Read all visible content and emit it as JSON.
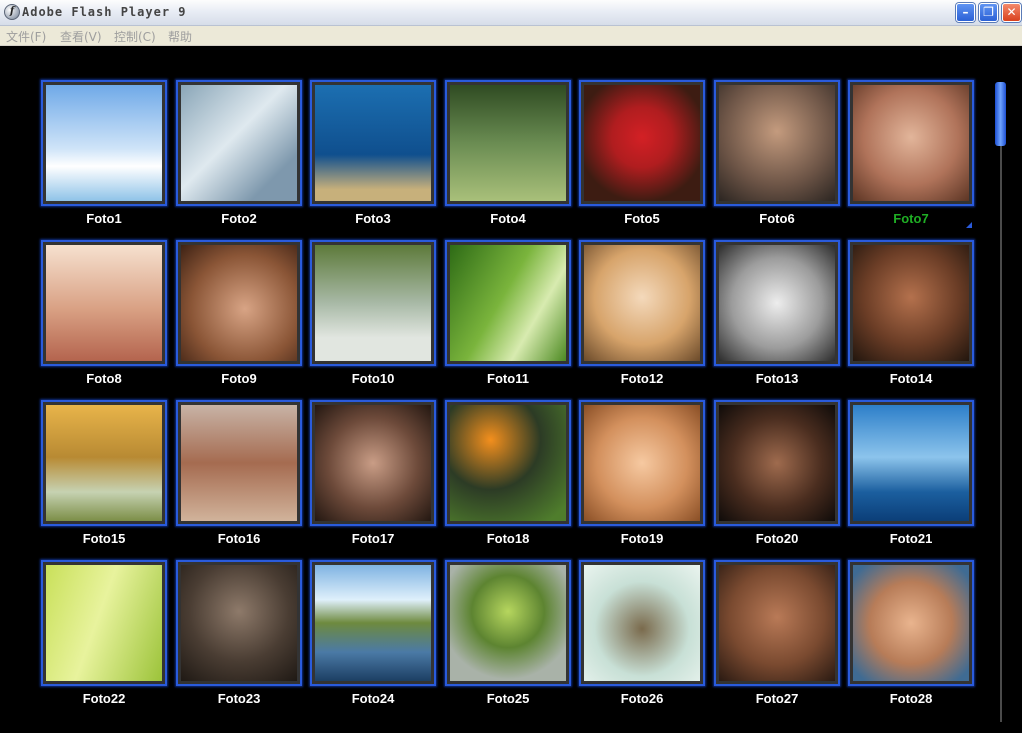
{
  "window": {
    "title": "Adobe Flash Player 9"
  },
  "menu": [
    "文件(F)",
    "查看(V)",
    "控制(C)",
    "帮助"
  ],
  "selected_index": 6,
  "photos": [
    {
      "label": "Foto1",
      "bg": "linear-gradient(#6fa9e8 0%, #cfe4f8 55%, #ffffff 70%, #8fc3e8 100%)"
    },
    {
      "label": "Foto2",
      "bg": "linear-gradient(135deg, #8aa6b8, #dfe9ef 45%, #7e98ad 80%)"
    },
    {
      "label": "Foto3",
      "bg": "linear-gradient(#1c6fb1, #0f4f8e 60%, #c7b07b 90%)"
    },
    {
      "label": "Foto4",
      "bg": "linear-gradient(#2f4b22, #6a8c52 50%, #a9c07a 100%)"
    },
    {
      "label": "Foto5",
      "bg": "radial-gradient(circle at 50% 45%, #d32025 0%, #b01d1f 35%, #3d1c12 75%)"
    },
    {
      "label": "Foto6",
      "bg": "radial-gradient(circle at 50% 40%, #c49b7e, #6c5446 60%, #2b2521)"
    },
    {
      "label": "Foto7",
      "bg": "radial-gradient(circle at 50% 45%, #e2b59a, #b0735a 55%, #5c3524)"
    },
    {
      "label": "Foto8",
      "bg": "linear-gradient(#f6e1cf, #d9a184 55%, #b4644e)"
    },
    {
      "label": "Foto9",
      "bg": "radial-gradient(circle at 55% 55%, #d8a485, #8a5536 60%, #3e2214)"
    },
    {
      "label": "Foto10",
      "bg": "linear-gradient(#5d7a3a, #a8b9a6 50%, #e1e6e0 80%)"
    },
    {
      "label": "Foto11",
      "bg": "linear-gradient(120deg, #2e6b16, #7ab43c 45%, #d8ebb0 70%, #4d8a22)"
    },
    {
      "label": "Foto12",
      "bg": "radial-gradient(circle at 50% 45%, #f4d9bb, #d7a46b 55%, #6b4a2a)"
    },
    {
      "label": "Foto13",
      "bg": "radial-gradient(circle at 50% 50%, #ededed, #9c9c9c 55%, #2c2c2c)"
    },
    {
      "label": "Foto14",
      "bg": "radial-gradient(circle at 50% 45%, #b4714d, #6b3d26 55%, #22160e)"
    },
    {
      "label": "Foto15",
      "bg": "linear-gradient(#e8b44a, #b88a33 45%, #c6d2b2 75%, #7c8e47)"
    },
    {
      "label": "Foto16",
      "bg": "linear-gradient(#c8b3a6, #a56b50 50%, #d1b39b)"
    },
    {
      "label": "Foto17",
      "bg": "radial-gradient(circle at 50% 50%, #c99d86, #6d4a3a 55%, #231711)"
    },
    {
      "label": "Foto18",
      "bg": "radial-gradient(circle at 35% 30%, #f38f1d, #2c3b25 45%, #4f7d2c 90%)"
    },
    {
      "label": "Foto19",
      "bg": "radial-gradient(circle at 50% 50%, #f6c9a1, #d3905d 55%, #8a4f26)"
    },
    {
      "label": "Foto20",
      "bg": "radial-gradient(circle at 50% 50%, #9f6b4e, #4a2d1f 55%, #0f0b09)"
    },
    {
      "label": "Foto21",
      "bg": "linear-gradient(#2d7fc9, #8cc4ec 45%, #1b5f9f 75%, #0b3e78)"
    },
    {
      "label": "Foto22",
      "bg": "linear-gradient(110deg, #c9e05a, #e8f39d 45%, #9cc33a)"
    },
    {
      "label": "Foto23",
      "bg": "radial-gradient(circle at 50% 40%, #8e7a6a, #4a3d33 55%, #1f1914)"
    },
    {
      "label": "Foto24",
      "bg": "linear-gradient(#7fb3e2, #dff0fb 30%, #6e8a3e 50%, #4b7aa6 75%, #1c3f63)"
    },
    {
      "label": "Foto25",
      "bg": "radial-gradient(circle at 50% 40%, #b6d65e, #5d8431 40%, #a9b2a8 75%)"
    },
    {
      "label": "Foto26",
      "bg": "radial-gradient(circle at 50% 55%, #7a6a4c, #c8e0d6 55%, #eaf4ef)"
    },
    {
      "label": "Foto27",
      "bg": "radial-gradient(circle at 50% 45%, #b97a57, #7a4a30 55%, #2a1a12)"
    },
    {
      "label": "Foto28",
      "bg": "radial-gradient(circle at 50% 50%, #e9b48e, #b77c58 50%, #3f6b93 90%)"
    }
  ],
  "colors": {
    "selected_caption": "#1fae24",
    "thumb_border": "#2a5bdc"
  }
}
